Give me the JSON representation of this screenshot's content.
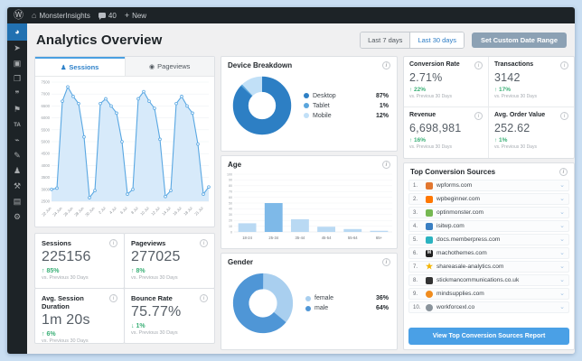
{
  "admin_bar": {
    "site_name": "MonsterInsights",
    "comments_count": "40",
    "new_label": "New"
  },
  "page": {
    "title": "Analytics Overview"
  },
  "date_range": {
    "last7": "Last 7 days",
    "last30": "Last 30 days",
    "custom": "Set Custom Date Range"
  },
  "tabs": {
    "sessions": "Sessions",
    "pageviews": "Pageviews"
  },
  "panels": {
    "device": {
      "title": "Device Breakdown"
    },
    "age": {
      "title": "Age"
    },
    "gender": {
      "title": "Gender"
    },
    "sources": {
      "title": "Top Conversion Sources",
      "button": "View Top Conversion Sources Report"
    }
  },
  "stats": {
    "sessions": {
      "label": "Sessions",
      "value": "225156",
      "change": "85%",
      "direction": "up",
      "compare": "vs. Previous 30 Days"
    },
    "pageviews": {
      "label": "Pageviews",
      "value": "277025",
      "change": "8%",
      "direction": "up",
      "compare": "vs. Previous 30 Days"
    },
    "duration": {
      "label": "Avg. Session Duration",
      "value": "1m 20s",
      "change": "6%",
      "direction": "up",
      "compare": "vs. Previous 30 Days"
    },
    "bounce": {
      "label": "Bounce Rate",
      "value": "75.77%",
      "change": "1%",
      "direction": "down",
      "compare": "vs. Previous 30 Days"
    },
    "conversion": {
      "label": "Conversion Rate",
      "value": "2.71%",
      "change": "22%",
      "direction": "up",
      "compare": "vs. Previous 30 Days"
    },
    "transactions": {
      "label": "Transactions",
      "value": "3142",
      "change": "17%",
      "direction": "up",
      "compare": "vs. Previous 30 Days"
    },
    "revenue": {
      "label": "Revenue",
      "value": "6,698,981",
      "change": "16%",
      "direction": "up",
      "compare": "vs. Previous 30 Days"
    },
    "aov": {
      "label": "Avg. Order Value",
      "value": "252.62",
      "change": "1%",
      "direction": "up",
      "compare": "vs. Previous 30 Days"
    }
  },
  "sources": [
    {
      "rank": "1.",
      "domain": "wpforms.com",
      "icon_color": "#e27730",
      "icon_type": "square"
    },
    {
      "rank": "2.",
      "domain": "wpbeginner.com",
      "icon_color": "#ff7700",
      "icon_type": "square"
    },
    {
      "rank": "3.",
      "domain": "optinmonster.com",
      "icon_color": "#76b852",
      "icon_type": "square"
    },
    {
      "rank": "4.",
      "domain": "isitwp.com",
      "icon_color": "#3a7fc2",
      "icon_type": "square"
    },
    {
      "rank": "5.",
      "domain": "docs.memberpress.com",
      "icon_color": "#2bb3c0",
      "icon_type": "square"
    },
    {
      "rank": "6.",
      "domain": "machothemes.com",
      "icon_color": "#222222",
      "icon_type": "letter",
      "letter": "M"
    },
    {
      "rank": "7.",
      "domain": "shareasale-analytics.com",
      "icon_color": "#f4b400",
      "icon_type": "star"
    },
    {
      "rank": "8.",
      "domain": "stickmancommunications.co.uk",
      "icon_color": "#333333",
      "icon_type": "square"
    },
    {
      "rank": "9.",
      "domain": "mindsupplies.com",
      "icon_color": "#f08c1e",
      "icon_type": "circle"
    },
    {
      "rank": "10.",
      "domain": "workforcexl.co",
      "icon_color": "#8a949c",
      "icon_type": "circle"
    }
  ],
  "sidebar": {
    "items": [
      {
        "name": "sidebar-item-dashboard",
        "glyph": "◕",
        "active": true
      },
      {
        "name": "sidebar-item-posts",
        "glyph": "➤"
      },
      {
        "name": "sidebar-item-media",
        "glyph": "▣"
      },
      {
        "name": "sidebar-item-pages",
        "glyph": "❐"
      },
      {
        "name": "sidebar-item-comments",
        "glyph": "❞"
      },
      {
        "name": "sidebar-item-forms",
        "glyph": "⚑"
      },
      {
        "name": "sidebar-item-ta",
        "glyph": "TA"
      },
      {
        "name": "sidebar-item-plugins",
        "glyph": "⌁"
      },
      {
        "name": "sidebar-item-appearance",
        "glyph": "✎"
      },
      {
        "name": "sidebar-item-users",
        "glyph": "♟"
      },
      {
        "name": "sidebar-item-tools",
        "glyph": "⚒"
      },
      {
        "name": "sidebar-item-settings",
        "glyph": "▤"
      },
      {
        "name": "sidebar-item-collapse",
        "glyph": "⚙"
      }
    ]
  },
  "icons": {
    "wordpress": "Ⓦ",
    "home": "⌂",
    "plus": "+",
    "user": "♟",
    "eye": "◉",
    "info": "i",
    "chevron-down": "⌄",
    "arrow-up": "↑",
    "arrow-down": "↓",
    "star": "★"
  },
  "colors": {
    "accent_blue": "#4aa0e6",
    "green": "#3bb077",
    "admin_dark": "#1d2327",
    "active_blue": "#2271b1",
    "frame": "#c9def2"
  },
  "chart_data": [
    {
      "id": "sessions",
      "type": "area",
      "title": "Sessions",
      "x_labels": [
        "22 Jun",
        "24 Jun",
        "26 Jun",
        "28 Jun",
        "30 Jun",
        "2 Jul",
        "4 Jul",
        "6 Jul",
        "8 Jul",
        "10 Jul",
        "12 Jul",
        "14 Jul",
        "16 Jul",
        "18 Jul",
        "21 Jul"
      ],
      "values": [
        3000,
        3050,
        6700,
        7300,
        6900,
        6600,
        5200,
        2650,
        2950,
        6600,
        6800,
        6500,
        6200,
        5000,
        2800,
        3000,
        6800,
        7100,
        6700,
        6400,
        5100,
        2700,
        2950,
        6600,
        6900,
        6500,
        6200,
        4900,
        2800,
        3100
      ],
      "ylim": [
        2500,
        7500
      ],
      "y_ticks": [
        2500,
        3000,
        3500,
        4000,
        4500,
        5000,
        5500,
        6000,
        6500,
        7000,
        7500
      ],
      "line_color": "#59a7e2",
      "fill_color": "#d7eafa",
      "grid": true
    },
    {
      "id": "device",
      "type": "pie",
      "title": "Device Breakdown",
      "slices": [
        {
          "label": "Desktop",
          "pct": 87,
          "color": "#2d7fc4"
        },
        {
          "label": "Tablet",
          "pct": 1,
          "color": "#5aa5dc"
        },
        {
          "label": "Mobile",
          "pct": 12,
          "color": "#c1e0f7"
        }
      ],
      "legend_position": "right"
    },
    {
      "id": "age",
      "type": "bar",
      "title": "Age",
      "categories": [
        "18-24",
        "25-34",
        "35-44",
        "45-54",
        "55-64",
        "65+"
      ],
      "values": [
        15,
        50,
        22,
        9,
        5,
        2
      ],
      "ylim": [
        0,
        100
      ],
      "y_ticks": [
        0,
        10,
        20,
        30,
        40,
        50,
        60,
        70,
        80,
        90,
        100
      ],
      "bar_color": "#b9d9f3",
      "highlight_index": 1,
      "highlight_color": "#7eb9e8",
      "grid": true
    },
    {
      "id": "gender",
      "type": "pie",
      "title": "Gender",
      "slices": [
        {
          "label": "female",
          "pct": 36,
          "color": "#a9cfef"
        },
        {
          "label": "male",
          "pct": 64,
          "color": "#4f96d6"
        }
      ],
      "legend_position": "right"
    }
  ]
}
